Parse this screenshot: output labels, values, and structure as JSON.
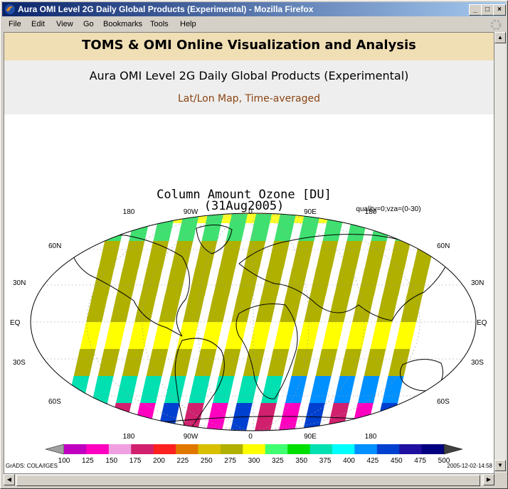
{
  "window": {
    "title": "Aura OMI Level 2G Daily Global Products (Experimental) - Mozilla Firefox"
  },
  "menu": [
    "File",
    "Edit",
    "View",
    "Go",
    "Bookmarks",
    "Tools",
    "Help"
  ],
  "page": {
    "banner": "TOMS & OMI Online Visualization and Analysis",
    "subtitle": "Aura OMI Level 2G Daily Global Products (Experimental)",
    "map_type": "Lat/Lon Map, Time-averaged"
  },
  "plot": {
    "title_line1": "Column Amount Ozone [DU]",
    "title_line2": "(31Aug2005)",
    "qualifier": "quality=0;vza=(0-30)",
    "lon_labels": [
      "180",
      "90W",
      "0",
      "90E",
      "180"
    ],
    "lat_labels_left": [
      "60N",
      "30N",
      "EQ",
      "30S",
      "60S"
    ],
    "lat_labels_right": [
      "60N",
      "30N",
      "EQ",
      "30S",
      "60S"
    ],
    "footer_left": "GrADS: COLA/IGES",
    "footer_right": "2005-12-02-14:58"
  },
  "colorbar": {
    "ticks": [
      "100",
      "125",
      "150",
      "175",
      "200",
      "225",
      "250",
      "275",
      "300",
      "325",
      "350",
      "375",
      "400",
      "425",
      "450",
      "475",
      "500"
    ],
    "colors": [
      "#a0a0a0",
      "#c000c0",
      "#ff00c0",
      "#f0a0e0",
      "#d0206e",
      "#ff2020",
      "#e07800",
      "#d8c000",
      "#b0b000",
      "#ffff00",
      "#40ff70",
      "#00e000",
      "#00e0b0",
      "#00ffff",
      "#0090ff",
      "#0040d0",
      "#2010a0",
      "#000080",
      "#404040"
    ]
  }
}
